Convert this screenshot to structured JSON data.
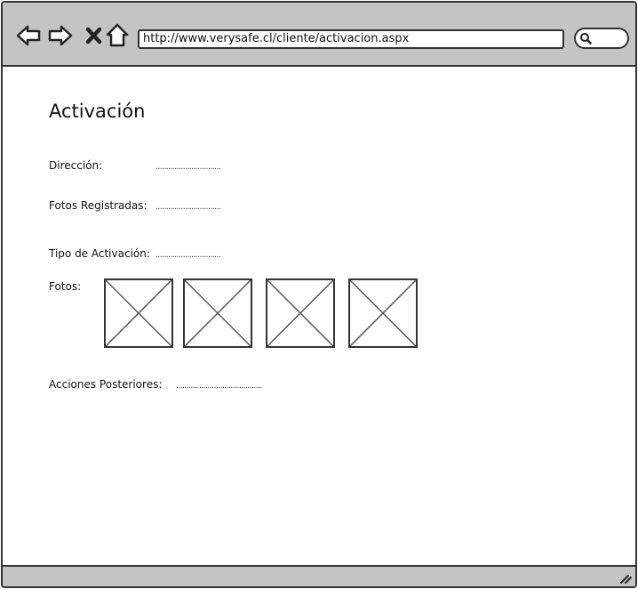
{
  "browser": {
    "url": "http://www.verysafe.cl/cliente/activacion.aspx",
    "nav_icons": [
      "back-arrow-icon",
      "forward-arrow-icon",
      "close-icon",
      "home-icon"
    ],
    "search_icon": "search-icon"
  },
  "page": {
    "title": "Activación",
    "fields": {
      "direccion": {
        "label": "Dirección:",
        "value": "..............................."
      },
      "fotos_registradas": {
        "label": "Fotos Registradas:",
        "value": "..............................."
      },
      "tipo_activacion": {
        "label": "Tipo de Activación:",
        "value": "..............................."
      },
      "fotos": {
        "label": "Fotos:"
      },
      "acciones": {
        "label": "Acciones Posteriores:",
        "value": "........................................."
      }
    },
    "photo_count": 4
  },
  "colors": {
    "chrome": "#c4c4c4",
    "border": "#333333"
  }
}
